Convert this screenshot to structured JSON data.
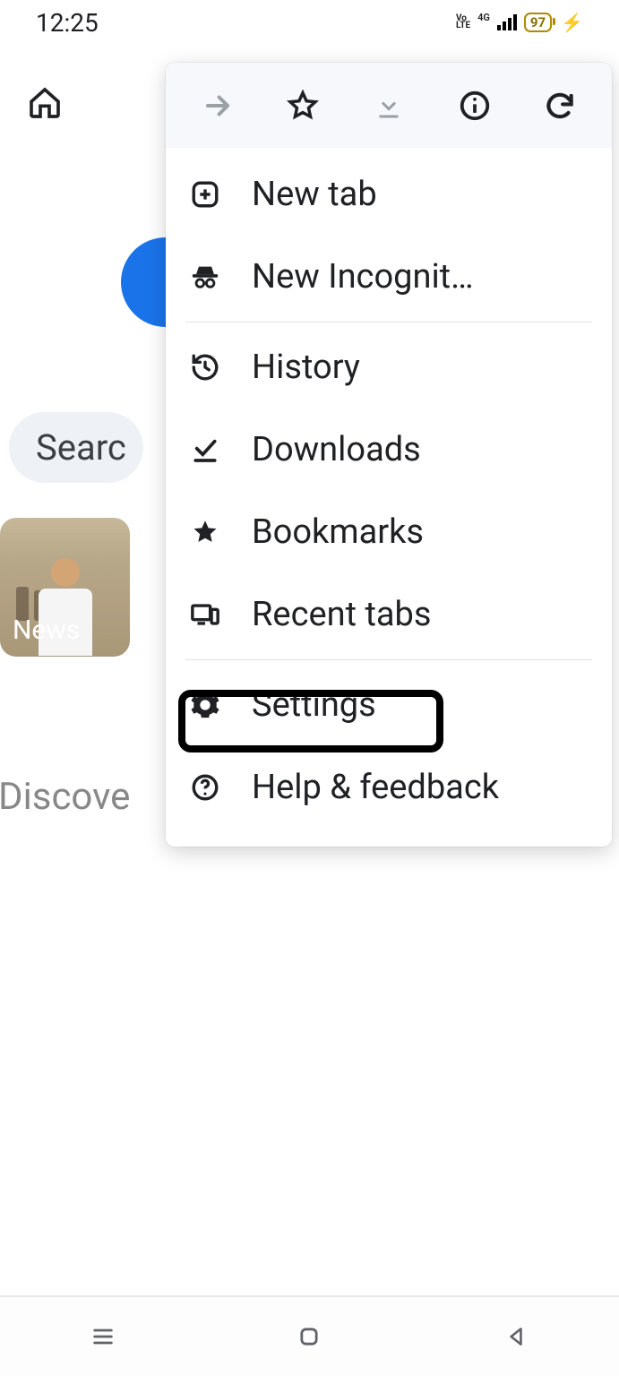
{
  "status": {
    "time": "12:25",
    "volte": "Vo\nLTE",
    "signal_label": "4G",
    "battery": "97"
  },
  "browser": {
    "home_icon": "home"
  },
  "background": {
    "search_text": "Searc",
    "news_label": "News",
    "discover_text": "Discove"
  },
  "menu": {
    "top_icons": [
      "forward",
      "star",
      "download",
      "info",
      "refresh"
    ],
    "items": [
      {
        "icon": "plus-box",
        "label": "New tab"
      },
      {
        "icon": "incognito",
        "label": "New Incognit…"
      },
      {
        "divider": true
      },
      {
        "icon": "history",
        "label": "History"
      },
      {
        "icon": "download-done",
        "label": "Downloads"
      },
      {
        "icon": "star-fill",
        "label": "Bookmarks"
      },
      {
        "icon": "devices",
        "label": "Recent tabs"
      },
      {
        "divider": true
      },
      {
        "icon": "gear",
        "label": "Settings",
        "highlight": true
      },
      {
        "icon": "help",
        "label": "Help & feedback"
      }
    ]
  },
  "nav": {
    "icons": [
      "recents",
      "home",
      "back"
    ]
  }
}
